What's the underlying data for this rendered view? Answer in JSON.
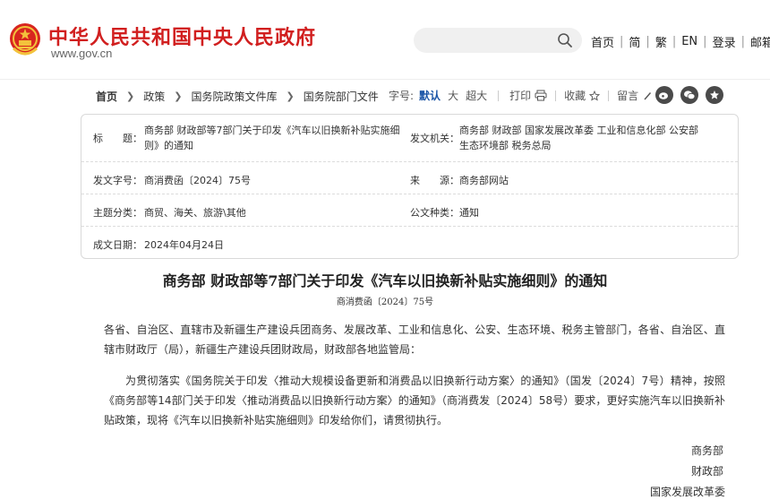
{
  "header": {
    "site_title": "中华人民共和国中央人民政府",
    "site_url": "www.gov.cn",
    "search_placeholder": "",
    "links": [
      "首页",
      "简",
      "繁",
      "EN",
      "登录",
      "邮箱"
    ]
  },
  "breadcrumb": [
    "首页",
    "政策",
    "国务院政策文件库",
    "国务院部门文件"
  ],
  "tools": {
    "font_label": "字号:",
    "font_sizes": [
      "默认",
      "大",
      "超大"
    ],
    "print": "打印",
    "favorite": "收藏",
    "comment": "留言"
  },
  "info": {
    "title_label": "标　　题：",
    "title_value": "商务部 财政部等7部门关于印发《汽车以旧换新补贴实施细则》的通知",
    "issuer_label": "发文机关：",
    "issuer_value": "商务部 财政部 国家发展改革委 工业和信息化部 公安部 生态环境部 税务总局",
    "docno_label": "发文字号：",
    "docno_value": "商消费函〔2024〕75号",
    "source_label": "来　　源：",
    "source_value": "商务部网站",
    "topic_label": "主题分类：",
    "topic_value": "商贸、海关、旅游\\其他",
    "type_label": "公文种类：",
    "type_value": "通知",
    "date_label": "成文日期：",
    "date_value": "2024年04月24日"
  },
  "document": {
    "title": "商务部 财政部等7部门关于印发《汽车以旧换新补贴实施细则》的通知",
    "doc_no": "商消费函〔2024〕75号",
    "salutation": "各省、自治区、直辖市及新疆生产建设兵团商务、发展改革、工业和信息化、公安、生态环境、税务主管部门，各省、自治区、直辖市财政厅（局），新疆生产建设兵团财政局，财政部各地监管局：",
    "body": "为贯彻落实《国务院关于印发〈推动大规模设备更新和消费品以旧换新行动方案〉的通知》（国发〔2024〕7号）精神，按照《商务部等14部门关于印发〈推动消费品以旧换新行动方案〉的通知》（商消费发〔2024〕58号）要求，更好实施汽车以旧换新补贴政策，现将《汽车以旧换新补贴实施细则》印发给你们，请贯彻执行。",
    "signatures": [
      "商务部",
      "财政部",
      "国家发展改革委"
    ]
  }
}
